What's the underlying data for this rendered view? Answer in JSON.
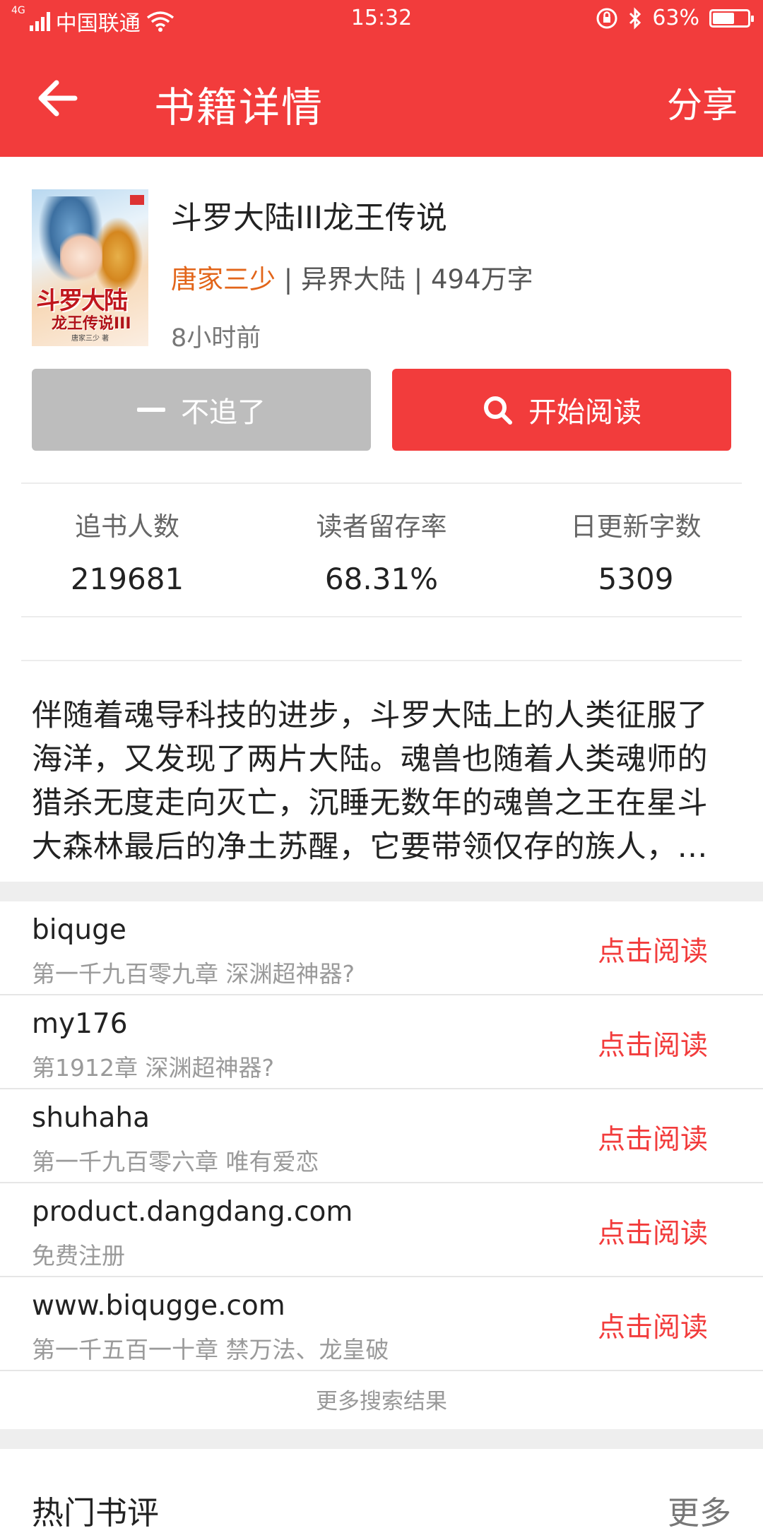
{
  "status_bar": {
    "network_type": "4G",
    "carrier": "中国联通",
    "time": "15:32",
    "battery_percent": "63%",
    "battery_level": 0.63,
    "icons": [
      "signal-icon",
      "wifi-icon",
      "rotation-lock-icon",
      "bluetooth-icon",
      "battery-icon"
    ]
  },
  "header": {
    "title": "书籍详情",
    "share_label": "分享",
    "back_icon": "arrow-left-icon"
  },
  "book": {
    "title": "斗罗大陆III龙王传说",
    "author": "唐家三少",
    "separator": " | ",
    "category": "异界大陆",
    "word_count": "494万字",
    "updated": "8小时前",
    "cover": {
      "title_line1": "斗罗大陆",
      "title_line2": "龙王传说III",
      "credit": "唐家三少 著"
    }
  },
  "actions": {
    "unfollow_label": "不追了",
    "read_label": "开始阅读"
  },
  "stats": [
    {
      "label": "追书人数",
      "value": "219681"
    },
    {
      "label": "读者留存率",
      "value": "68.31%"
    },
    {
      "label": "日更新字数",
      "value": "5309"
    }
  ],
  "description": "伴随着魂导科技的进步，斗罗大陆上的人类征服了海洋，又发现了两片大陆。魂兽也随着人类魂师的猎杀无度走向灭亡，沉睡无数年的魂兽之王在星斗大森林最后的净土苏醒，它要带领仅存的族人，…",
  "sources": [
    {
      "name": "biquge",
      "chapter": "第一千九百零九章 深渊超神器?",
      "action": "点击阅读"
    },
    {
      "name": "my176",
      "chapter": "第1912章 深渊超神器?",
      "action": "点击阅读"
    },
    {
      "name": "shuhaha",
      "chapter": "第一千九百零六章 唯有爱恋",
      "action": "点击阅读"
    },
    {
      "name": "product.dangdang.com",
      "chapter": "免费注册",
      "action": "点击阅读"
    },
    {
      "name": "www.biqugge.com",
      "chapter": "第一千五百一十章 禁万法、龙皇破",
      "action": "点击阅读"
    }
  ],
  "more_results_label": "更多搜索结果",
  "reviews": {
    "title": "热门书评",
    "more_label": "更多"
  },
  "colors": {
    "brand_red": "#f23c3c",
    "author_orange": "#e2651a",
    "disabled_gray": "#bdbdbd"
  }
}
